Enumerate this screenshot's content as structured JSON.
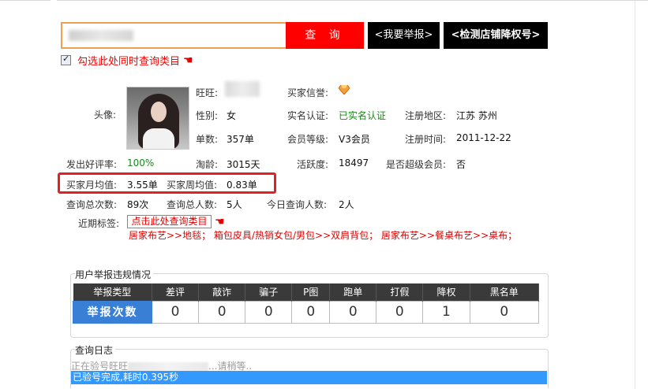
{
  "search": {
    "placeholder": "",
    "query_label": "查 询",
    "report_label": "<我要举报>",
    "detect_label": "<检测店铺降权号>"
  },
  "option": {
    "checked": true,
    "label": "勾选此处同时查询类目"
  },
  "profile": {
    "avatar_label": "头像:",
    "wangwang_label": "旺旺:",
    "buyer_credit_label": "买家信誉:",
    "gender_label": "性别:",
    "gender": "女",
    "realname_label": "实名认证:",
    "realname": "已实名认证",
    "region_label": "注册地区:",
    "region": "江苏 苏州",
    "orders_label": "单数:",
    "orders": "357单",
    "member_level_label": "会员等级:",
    "member_level": "V3会员",
    "reg_time_label": "注册时间:",
    "reg_time": "2011-12-22",
    "good_rate_label": "发出好评率:",
    "good_rate": "100%",
    "tb_age_label": "淘龄:",
    "tb_age": "3015天",
    "activity_label": "活跃度:",
    "activity": "18497",
    "super_member_label": "是否超级会员:",
    "super_member": "否",
    "monthly_avg_label": "买家月均值:",
    "monthly_avg": "3.55单",
    "weekly_avg_label": "买家周均值:",
    "weekly_avg": "0.83单",
    "query_total_label": "查询总次数:",
    "query_total": "89次",
    "query_people_label": "查询总人数:",
    "query_people": "5人",
    "today_people_label": "今日查询人数:",
    "today_people": "2人",
    "tags_label": "近期标签:",
    "tags_button": "点击此处查询类目",
    "categories": "居家布艺>>地毯； 箱包皮具/热销女包/男包>>双肩背包； 居家布艺>>餐桌布艺>>桌布；"
  },
  "report": {
    "title": "用户举报违规情况",
    "headers": [
      "举报类型",
      "差评",
      "敲诈",
      "骗子",
      "P图",
      "跑单",
      "打假",
      "降权",
      "黑名单"
    ],
    "row_label": "举报次数",
    "counts": [
      "0",
      "0",
      "0",
      "0",
      "0",
      "0",
      "1",
      "0"
    ]
  },
  "log": {
    "title": "查询日志",
    "line1": "正在验号旺旺",
    "line1_tail": "...请稍等..",
    "line2": "已验号完成,耗时0.395秒"
  },
  "colors": {
    "accent": "#ff0000",
    "highlight": "#e42020",
    "table_header": "#3a3a3a",
    "row_head": "#3a7fd6",
    "log_selected": "#3399ff"
  }
}
